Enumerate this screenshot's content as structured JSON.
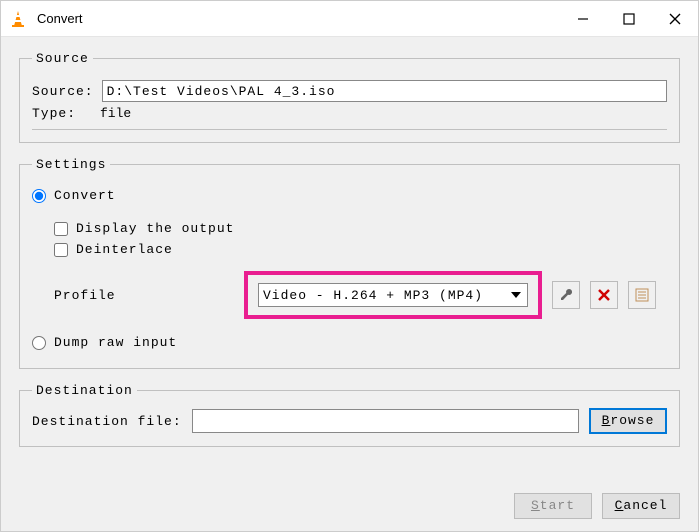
{
  "window": {
    "title": "Convert"
  },
  "source": {
    "legend": "Source",
    "source_label": "Source:",
    "source_value": "D:\\Test Videos\\PAL 4_3.iso",
    "type_label": "Type:",
    "type_value": "file"
  },
  "settings": {
    "legend": "Settings",
    "convert_label": "Convert",
    "convert_checked": true,
    "display_output_label": "Display the output",
    "display_output_checked": false,
    "deinterlace_label": "Deinterlace",
    "deinterlace_checked": false,
    "profile_label": "Profile",
    "profile_value": "Video - H.264 + MP3 (MP4)",
    "dump_label": "Dump raw input",
    "dump_checked": false
  },
  "destination": {
    "legend": "Destination",
    "file_label": "Destination file:",
    "file_value": "",
    "browse_label_pre": "",
    "browse_underline": "B",
    "browse_label_post": "rowse"
  },
  "footer": {
    "start_underline": "S",
    "start_post": "tart",
    "cancel_pre": "",
    "cancel_underline": "C",
    "cancel_post": "ancel"
  }
}
